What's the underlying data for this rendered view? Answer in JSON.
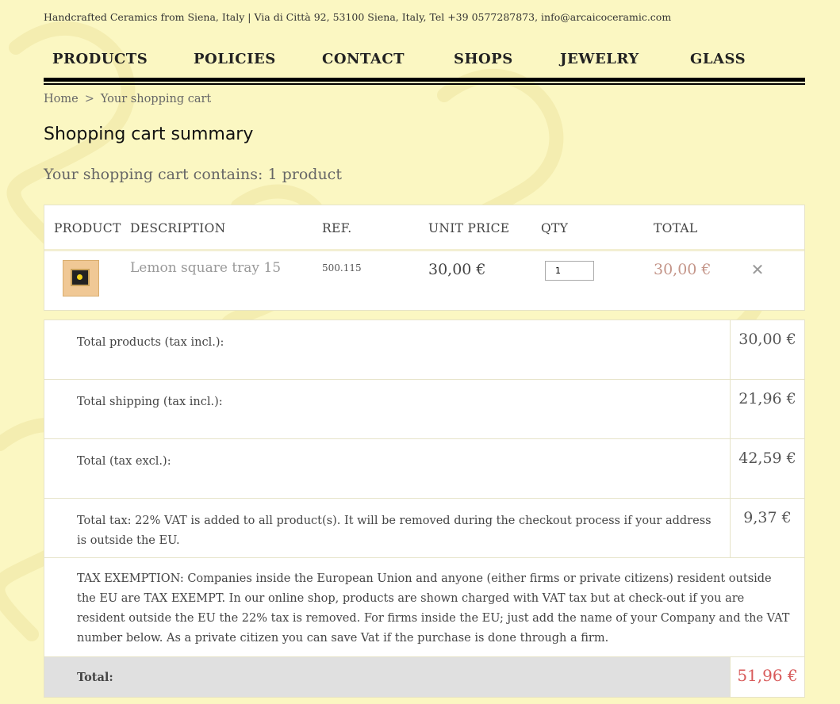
{
  "header": {
    "info": "Handcrafted Ceramics from Siena, Italy | Via di Città 92, 53100 Siena, Italy, Tel +39 0577287873, info@arcaicoceramic.com"
  },
  "nav": {
    "items": [
      "PRODUCTS",
      "POLICIES",
      "CONTACT",
      "SHOPS",
      "JEWELRY",
      "GLASS"
    ]
  },
  "breadcrumb": {
    "home": "Home",
    "separator": ">",
    "current": "Your shopping cart"
  },
  "page": {
    "title": "Shopping cart summary",
    "cart_count": "Your shopping cart contains: 1 product"
  },
  "cart": {
    "headers": {
      "product": "PRODUCT",
      "description": "DESCRIPTION",
      "ref": "REF.",
      "unit_price": "UNIT PRICE",
      "qty": "QTY",
      "total": "TOTAL"
    },
    "items": [
      {
        "name": "Lemon square tray 15",
        "ref": "500.115",
        "unit_price": "30,00 €",
        "qty": "1",
        "total": "30,00 €",
        "remove_icon": "close-icon"
      }
    ]
  },
  "summary": {
    "total_products_label": "Total products (tax incl.):",
    "total_products_value": "30,00 €",
    "total_shipping_label": "Total shipping (tax incl.):",
    "total_shipping_value": "21,96 €",
    "total_tax_excl_label": "Total (tax excl.):",
    "total_tax_excl_value": "42,59 €",
    "total_tax_label": "Total tax: 22% VAT is added to all product(s). It will be removed during the checkout process if your address is outside the EU.",
    "total_tax_value": "9,37 €",
    "tax_exemption": "TAX EXEMPTION: Companies inside the European Union and anyone (either firms or private citizens) resident outside the EU are TAX EXEMPT. In our online shop, products are shown charged with VAT tax but at check-out if you are resident outside the EU the 22% tax is removed. For firms inside the EU; just add the name of your Company and the VAT number below. As a private citizen you can save Vat if the purchase is done through a firm.",
    "total_label": "Total:",
    "total_value": "51,96 €"
  },
  "colors": {
    "background": "#fbf7c2",
    "total_accent": "#d85a5a",
    "line_total": "#c49589"
  }
}
